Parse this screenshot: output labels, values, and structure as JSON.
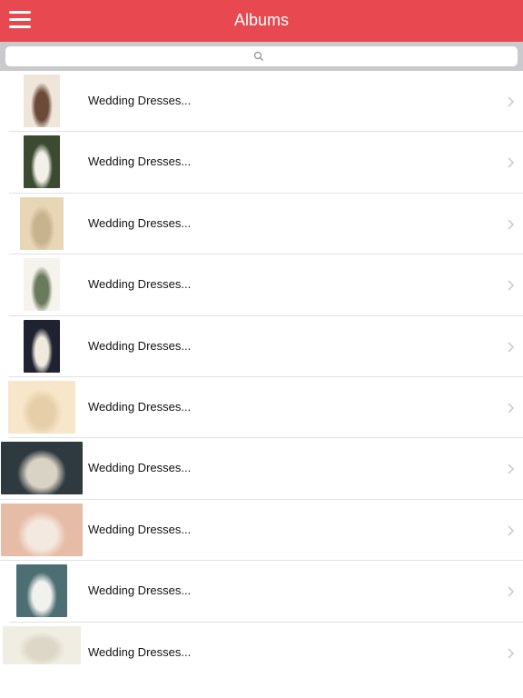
{
  "navbar": {
    "title": "Albums",
    "menu_icon": "hamburger-menu-icon"
  },
  "search": {
    "placeholder": "",
    "icon": "search-icon"
  },
  "albums": [
    {
      "label": "Wedding Dresses...",
      "thumb_colors": [
        "#efe5d8",
        "#6b4a3a"
      ]
    },
    {
      "label": "Wedding Dresses...",
      "thumb_colors": [
        "#3c4b2f",
        "#f3f0ea"
      ]
    },
    {
      "label": "Wedding Dresses...",
      "thumb_colors": [
        "#e9d6b7",
        "#c8b38f"
      ]
    },
    {
      "label": "Wedding Dresses...",
      "thumb_colors": [
        "#f6f2ec",
        "#6a7a5c"
      ]
    },
    {
      "label": "Wedding Dresses...",
      "thumb_colors": [
        "#1f2230",
        "#efe9de"
      ]
    },
    {
      "label": "Wedding Dresses...",
      "thumb_colors": [
        "#f7e6c9",
        "#e6cfa8"
      ]
    },
    {
      "label": "Wedding Dresses...",
      "thumb_colors": [
        "#2e3a3f",
        "#d9d3c5"
      ]
    },
    {
      "label": "Wedding Dresses...",
      "thumb_colors": [
        "#e6bca6",
        "#f4e9e0"
      ]
    },
    {
      "label": "Wedding Dresses...",
      "thumb_colors": [
        "#4d6f74",
        "#f1f1ee"
      ]
    },
    {
      "label": "Wedding Dresses...",
      "thumb_colors": [
        "#f0ede2",
        "#dcd7c7"
      ]
    }
  ],
  "colors": {
    "accent": "#e8484f",
    "chevron": "#c7c7cc"
  }
}
